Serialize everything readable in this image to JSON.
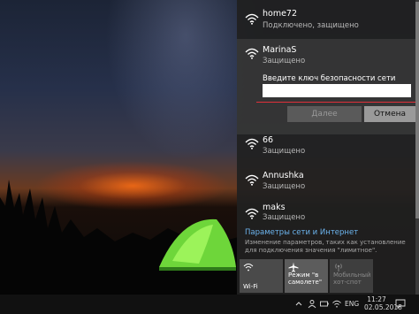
{
  "networks": [
    {
      "name": "home72",
      "status": "Подключено, защищено"
    },
    {
      "name": "MarinaS",
      "status": "Защищено"
    },
    {
      "name": "66",
      "status": "Защищено"
    },
    {
      "name": "Annushka",
      "status": "Защищено"
    },
    {
      "name": "maks",
      "status": "Защищено"
    }
  ],
  "security_prompt": {
    "label": "Введите ключ безопасности сети",
    "value": "",
    "next_button": "Далее",
    "cancel_button": "Отмена"
  },
  "settings": {
    "link": "Параметры сети и Интернет",
    "description": "Изменение параметров, таких как установление для подключения значения \"лимитное\"."
  },
  "quick_actions": [
    {
      "label": "Wi-Fi",
      "icon": "wifi-icon"
    },
    {
      "label": "Режим \"в самолете\"",
      "icon": "airplane-icon"
    },
    {
      "label": "Мобильный хот-спот",
      "icon": "hotspot-icon"
    }
  ],
  "taskbar": {
    "language": "ENG",
    "time": "11:27",
    "date": "02.05.2018"
  },
  "colors": {
    "accent": "#e0303a",
    "link": "#6cb4ee",
    "panel": "#202020"
  }
}
